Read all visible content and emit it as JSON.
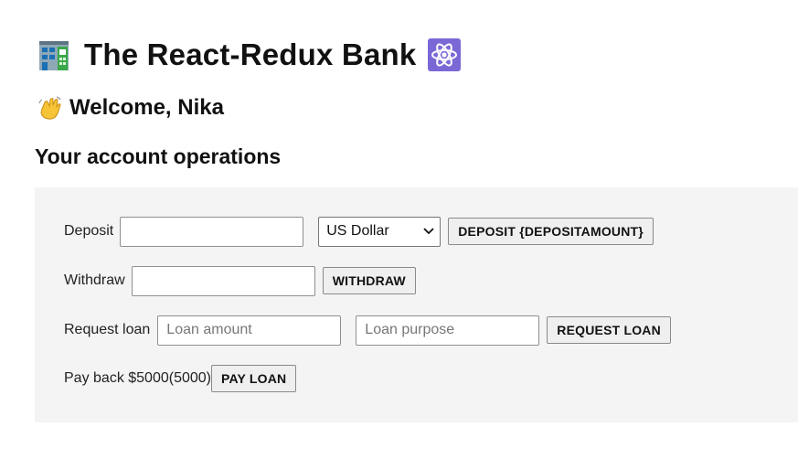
{
  "header": {
    "title": "The React-Redux Bank",
    "bank_icon": "office-building-icon",
    "react_icon": "atom-symbol-icon"
  },
  "welcome": {
    "text": "Welcome, Nika",
    "icon": "waving-hand-icon"
  },
  "section_title": "Your account operations",
  "operations": {
    "deposit": {
      "label": "Deposit",
      "input_value": "",
      "currency_selected": "US Dollar",
      "button_label": "DEPOSIT {DEPOSITAMOUNT}"
    },
    "withdraw": {
      "label": "Withdraw",
      "input_value": "",
      "button_label": "WITHDRAW"
    },
    "loan": {
      "label": "Request loan",
      "amount_placeholder": "Loan amount",
      "purpose_placeholder": "Loan purpose",
      "button_label": "REQUEST LOAN"
    },
    "payback": {
      "label": "Pay back $5000(5000)",
      "button_label": "PAY LOAN"
    }
  },
  "colors": {
    "panel_bg": "#f4f4f4",
    "react_icon_bg": "#7b68d6"
  }
}
